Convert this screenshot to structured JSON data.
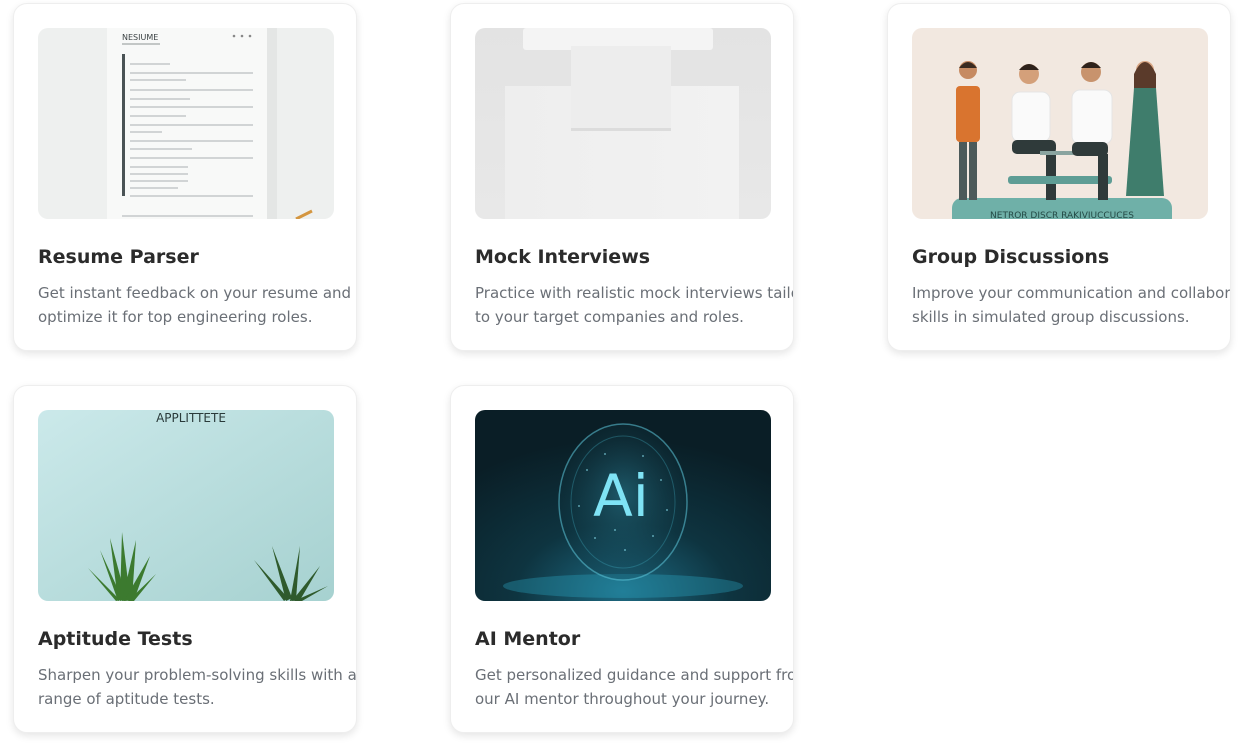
{
  "cards": [
    {
      "title": "Resume Parser",
      "desc_line1": "Get instant feedback on your resume and",
      "desc_line2": "optimize it for top engineering roles.",
      "image_text": "NESIUME"
    },
    {
      "title": "Mock Interviews",
      "desc_line1": "Practice with realistic mock interviews tailo",
      "desc_line2": "to your target companies and roles."
    },
    {
      "title": "Group Discussions",
      "desc_line1": "Improve your communication and collaborat",
      "desc_line2": "skills in simulated group discussions.",
      "image_text": "NETROR DISCR RAKIVIUCCUCES"
    },
    {
      "title": "Aptitude Tests",
      "desc_line1": "Sharpen your problem-solving skills with a v",
      "desc_line2": "range of aptitude tests.",
      "image_text": "APPLITTETE"
    },
    {
      "title": "AI Mentor",
      "desc_line1": "Get personalized guidance and support fror",
      "desc_line2": "our AI mentor throughout your journey.",
      "image_text": "Ai"
    }
  ],
  "colors": {
    "title": "#2b2b2b",
    "description": "#6a6f76",
    "card_border": "#eeeeee",
    "mentor_glow": "#7fe3f5"
  }
}
